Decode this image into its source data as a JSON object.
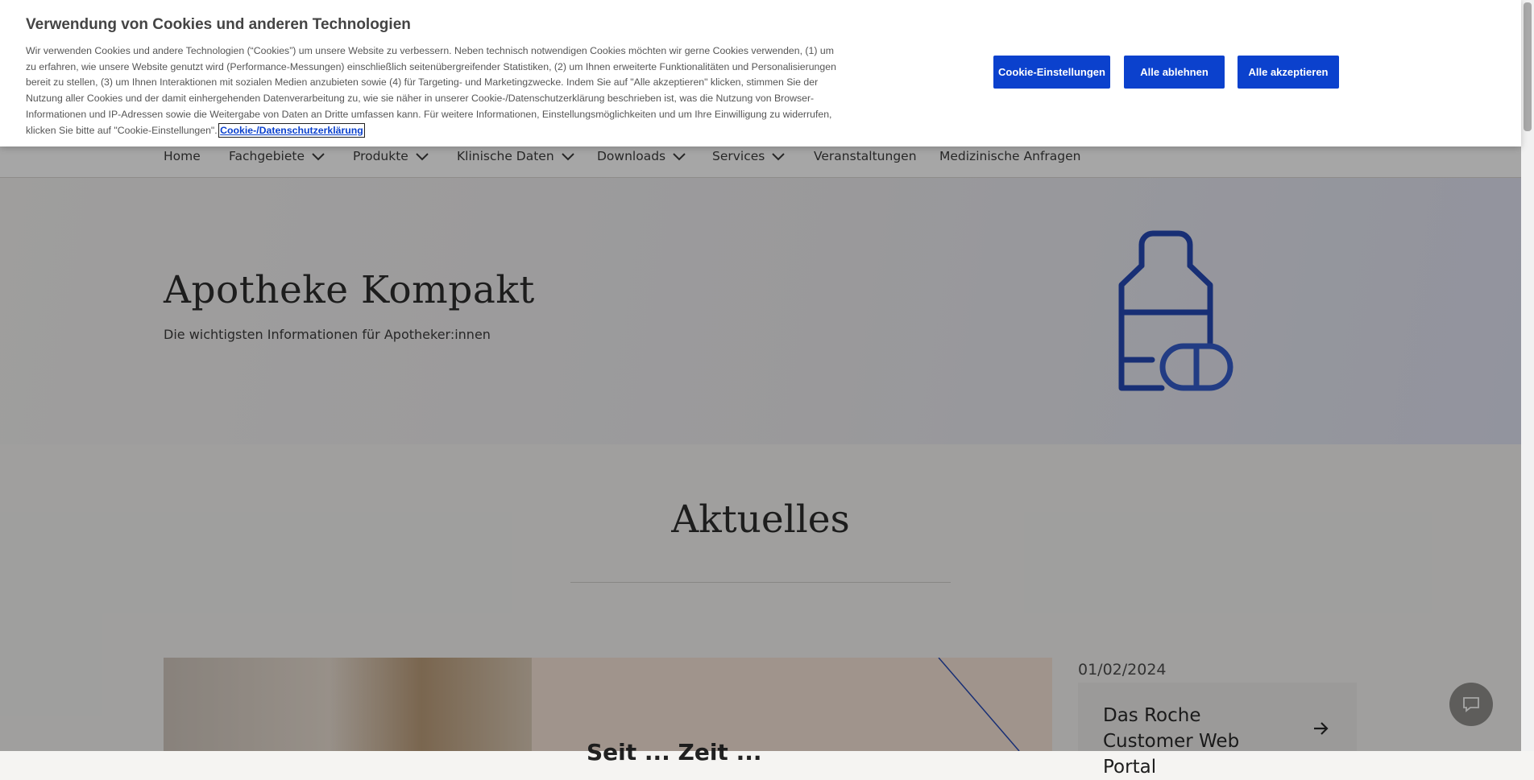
{
  "nav": {
    "items": [
      {
        "label": "Home"
      },
      {
        "label": "Fachgebiete"
      },
      {
        "label": "Produkte"
      },
      {
        "label": "Klinische Daten"
      },
      {
        "label": "Downloads"
      },
      {
        "label": "Services"
      },
      {
        "label": "Veranstaltungen"
      },
      {
        "label": "Medizinische Anfragen"
      }
    ]
  },
  "hero": {
    "title": "Apotheke Kompakt",
    "subtitle": "Die wichtigsten Informationen für Apotheker:innen",
    "icon": "medicine-bottle-pill-icon"
  },
  "aktuelles": {
    "title": "Aktuelles",
    "feature_heading": "Seit ... Zeit ...",
    "news": {
      "date": "01/02/2024",
      "title": "Das Roche Customer Web Portal"
    }
  },
  "cookie": {
    "title": "Verwendung von Cookies und anderen Technologien",
    "text": "Wir verwenden Cookies und andere Technologien (“Cookies”) um unsere Website zu verbessern. Neben technisch notwendigen Cookies möchten wir gerne Cookies verwenden, (1) um zu erfahren, wie unsere Website genutzt wird (Performance-Messungen) einschließlich seitenübergreifender Statistiken, (2) um Ihnen erweiterte Funktionalitäten und Personalisierungen bereit zu stellen, (3) um Ihnen Interaktionen mit sozialen Medien anzubieten sowie (4) für Targeting- und Marketingzwecke. Indem Sie auf \"Alle akzeptieren\" klicken, stimmen Sie der Nutzung aller Cookies und der damit einhergehenden Datenverarbeitung zu, wie sie näher in unserer Cookie-/Datenschutzerklärung beschrieben ist, was die Nutzung von Browser-Informationen und IP-Adressen sowie die Weitergabe von Daten an Dritte umfassen kann. Für weitere Informationen, Einstellungsmöglichkeiten und um Ihre Einwilligung zu widerrufen, klicken Sie bitte auf \"Cookie-Einstellungen\". ",
    "link": "Cookie-/Datenschutzerklärung",
    "btn_settings": "Cookie-Einstellungen",
    "btn_reject": "Alle ablehnen",
    "btn_accept": "Alle akzeptieren"
  },
  "colors": {
    "primary_blue": "#0b41cd",
    "overlay": "rgba(20,20,20,0.38)"
  }
}
